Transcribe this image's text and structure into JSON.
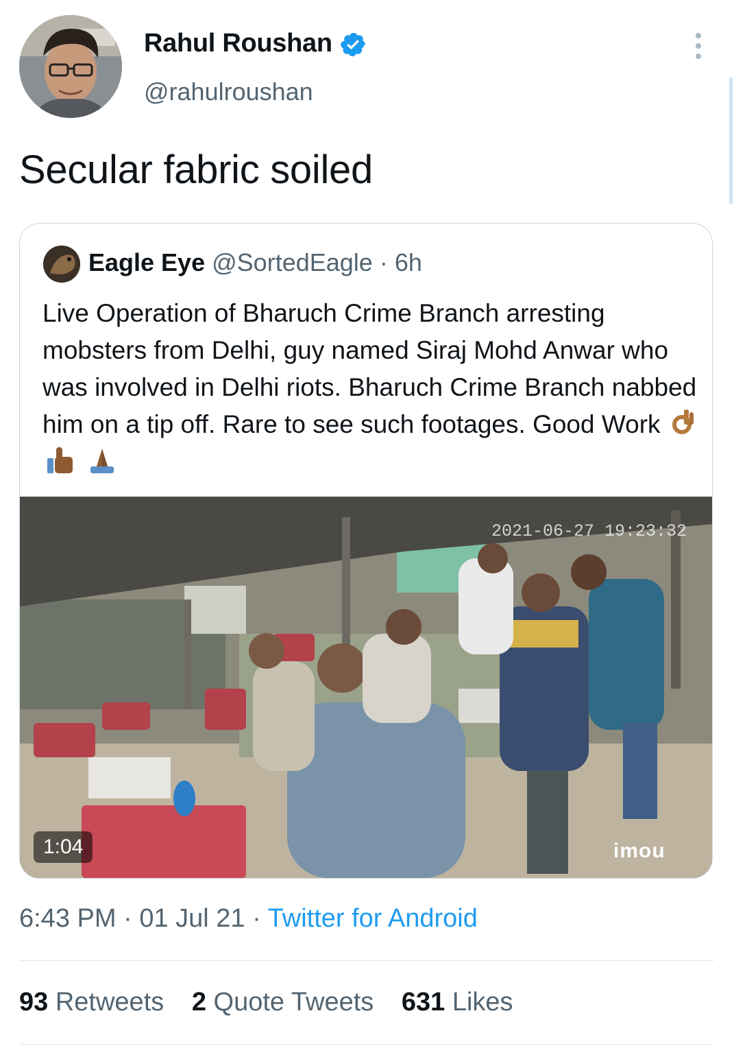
{
  "tweet": {
    "display_name": "Rahul Roushan",
    "handle": "@rahulroushan",
    "text": "Secular fabric soiled",
    "more_icon": "more-vertical-icon",
    "verified_icon": "verified-badge-icon",
    "time": "6:43 PM",
    "date": "01 Jul 21",
    "source": "Twitter for Android",
    "meta_sep": "·"
  },
  "quote": {
    "display_name": "Eagle Eye",
    "handle": "@SortedEagle",
    "sep": "·",
    "time": "6h",
    "text": "Live Operation of Bharuch Crime Branch arresting mobsters from Delhi, guy named Siraj Mohd Anwar who was involved in Delhi riots. Bharuch Crime Branch nabbed him on a tip off. Rare to see such footages. Good Work",
    "emojis": [
      "ok-hand-emoji",
      "thumbs-up-emoji",
      "folded-hands-emoji"
    ],
    "video": {
      "duration": "1:04",
      "cam_timestamp": "2021-06-27 19:23:32",
      "cam_brand": "imou"
    }
  },
  "stats": {
    "retweets_count": "93",
    "retweets_label": "Retweets",
    "quotes_count": "2",
    "quotes_label": "Quote Tweets",
    "likes_count": "631",
    "likes_label": "Likes"
  },
  "colors": {
    "accent": "#1d9bf0",
    "secondary_text": "#536471",
    "primary_text": "#0f1419"
  }
}
